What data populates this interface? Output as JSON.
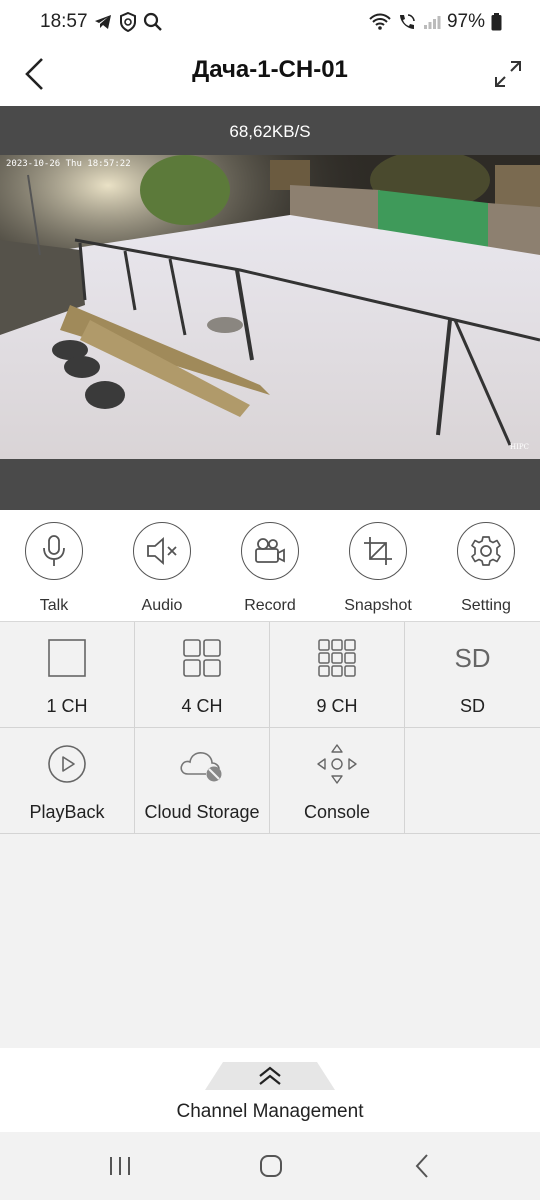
{
  "status_bar": {
    "time": "18:57",
    "left_icons": [
      "telegram-icon",
      "shield-icon",
      "search-icon"
    ],
    "right_icons": [
      "wifi-icon",
      "wifi-call-icon",
      "signal-icon",
      "battery-icon"
    ],
    "battery": "97%"
  },
  "header": {
    "title": "Дача-1-CH-01",
    "back_icon": "back-arrow-icon",
    "fullscreen_icon": "expand-icon"
  },
  "video": {
    "speed": "68,62KB/S",
    "overlay_timestamp": "2023-10-26 Thu 18:57:22",
    "watermark": "HIPC"
  },
  "actions": [
    {
      "label": "Talk",
      "icon": "microphone-icon"
    },
    {
      "label": "Audio",
      "icon": "speaker-muted-icon"
    },
    {
      "label": "Record",
      "icon": "video-camera-icon"
    },
    {
      "label": "Snapshot",
      "icon": "crop-icon"
    },
    {
      "label": "Setting",
      "icon": "gear-icon"
    }
  ],
  "grid": {
    "row1": [
      {
        "label": "1 CH",
        "icon": "single-view-icon"
      },
      {
        "label": "4 CH",
        "icon": "quad-view-icon"
      },
      {
        "label": "9 CH",
        "icon": "nine-view-icon"
      },
      {
        "label": "SD",
        "icon_text": "SD"
      }
    ],
    "row2": [
      {
        "label": "PlayBack",
        "icon": "play-circle-icon"
      },
      {
        "label": "Cloud Storage",
        "icon": "cloud-disabled-icon"
      },
      {
        "label": "Console",
        "icon": "ptz-directions-icon"
      }
    ]
  },
  "channel_management": {
    "label": "Channel Management",
    "icon": "double-chevron-up-icon"
  },
  "nav": {
    "recent": "recent-apps-icon",
    "home": "home-icon",
    "back": "back-icon"
  }
}
